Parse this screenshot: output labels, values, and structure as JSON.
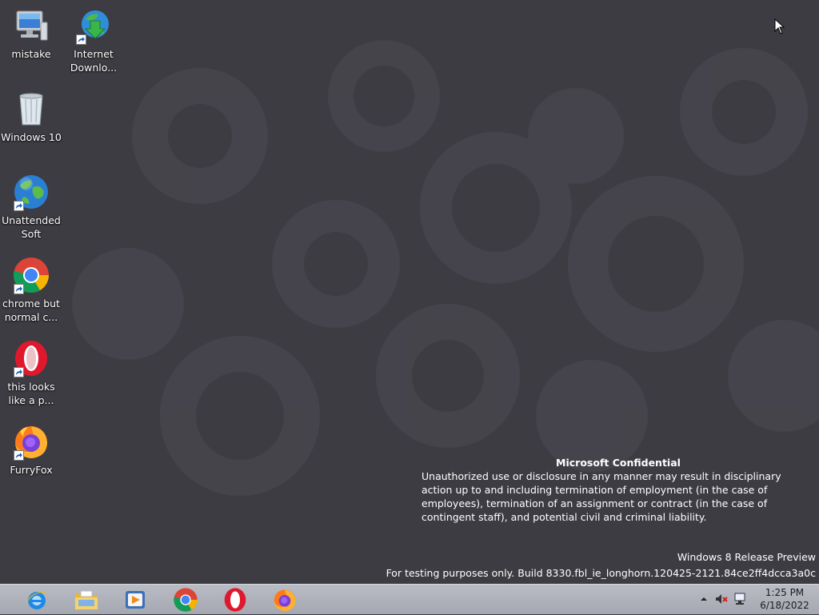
{
  "desktop": {
    "icons": [
      {
        "label": "mistake",
        "icon": "computer-icon"
      },
      {
        "label": "Internet\nDownlo...",
        "icon": "internet-download-manager-icon"
      },
      {
        "label": "Windows 10",
        "icon": "recycle-bin-icon"
      },
      {
        "label": "Unattended\nSoft",
        "icon": "globe-icon"
      },
      {
        "label": "chrome but\nnormal c...",
        "icon": "chrome-icon"
      },
      {
        "label": "this looks\nlike a p...",
        "icon": "opera-icon"
      },
      {
        "label": "FurryFox",
        "icon": "firefox-icon"
      }
    ]
  },
  "watermark": {
    "title": "Microsoft Confidential",
    "body": "Unauthorized use or disclosure in any manner may result in disciplinary action up to and including termination of employment (in the case of employees), termination of an assignment or contract (in the case of contingent staff), and potential civil and criminal liability.",
    "edition": "Windows 8 Release Preview",
    "build": "For testing purposes only. Build 8330.fbl_ie_longhorn.120425-2121.84ce2ff4dcca3a0c"
  },
  "taskbar": {
    "pinned": [
      {
        "name": "Internet Explorer",
        "icon": "internet-explorer-icon"
      },
      {
        "name": "File Explorer",
        "icon": "file-explorer-icon"
      },
      {
        "name": "Windows Media Player",
        "icon": "media-player-icon"
      },
      {
        "name": "Google Chrome",
        "icon": "chrome-icon"
      },
      {
        "name": "Opera",
        "icon": "opera-icon"
      },
      {
        "name": "Firefox",
        "icon": "firefox-icon"
      }
    ],
    "tray": {
      "icons": [
        "show-hidden-icons-arrow",
        "volume-muted-icon",
        "network-icon"
      ],
      "time": "1:25 PM",
      "date": "6/18/2022"
    }
  },
  "colors": {
    "desktop_bg": "#3d3c43",
    "taskbar_bg": "#b2b5bd",
    "opera_red": "#e0182d",
    "chrome_red": "#db4437",
    "chrome_green": "#0f9d58",
    "chrome_yellow": "#f4b400",
    "chrome_blue": "#4285f4"
  }
}
